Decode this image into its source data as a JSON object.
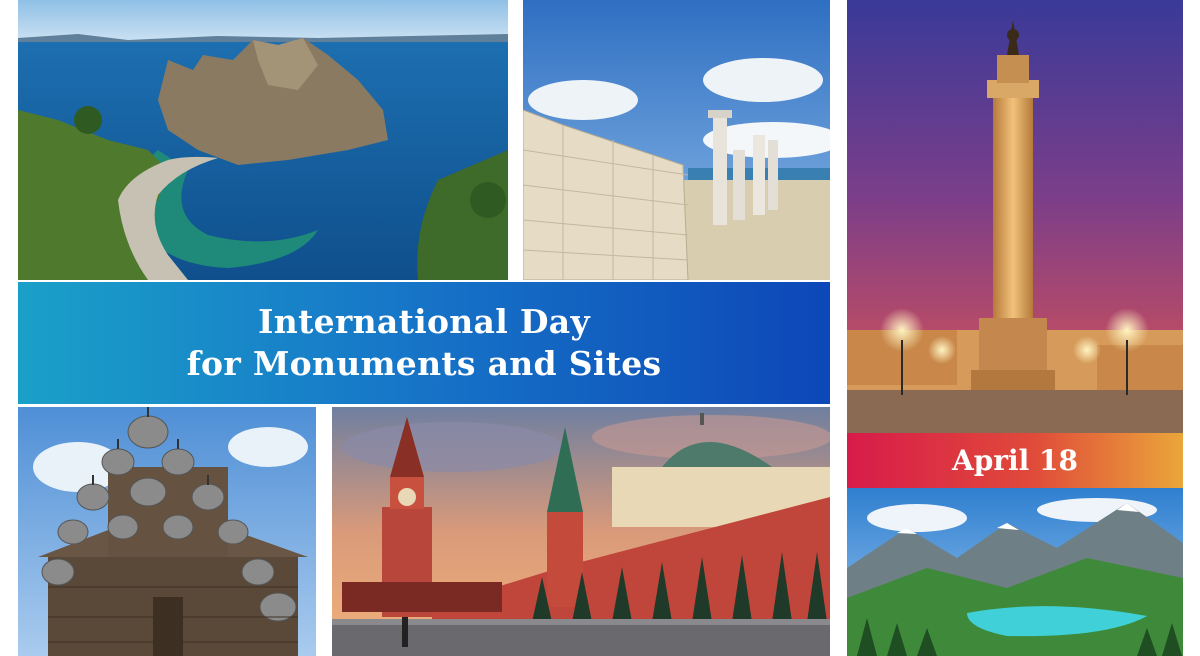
{
  "banner": {
    "title_line1": "International Day",
    "title_line2": "for Monuments and Sites"
  },
  "date_badge": {
    "text": "April 18"
  },
  "colors": {
    "title_gradient_start": "#1aa0c8",
    "title_gradient_end": "#0d47b8",
    "date_gradient_start": "#d81b4a",
    "date_gradient_end": "#eaa63a"
  }
}
